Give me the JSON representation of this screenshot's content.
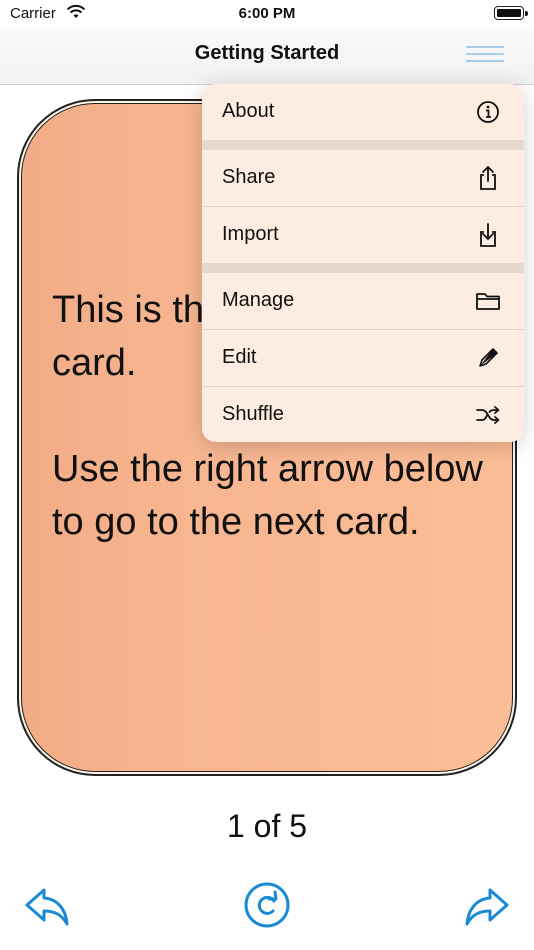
{
  "status": {
    "carrier": "Carrier",
    "time": "6:00 PM"
  },
  "nav": {
    "title": "Getting Started",
    "menu_icon": "hamburger-menu-icon"
  },
  "card": {
    "paragraph1": "This is the first card.",
    "paragraph2": "Use the right arrow below to go to the next card.",
    "visible_line1": "This is th",
    "visible_line2": "card."
  },
  "counter": "1 of 5",
  "menu": {
    "items": [
      {
        "label": "About",
        "icon": "info-circle-icon"
      },
      {
        "label": "Share",
        "icon": "share-icon"
      },
      {
        "label": "Import",
        "icon": "import-tray-icon"
      },
      {
        "label": "Manage",
        "icon": "folder-icon"
      },
      {
        "label": "Edit",
        "icon": "pencil-icon"
      },
      {
        "label": "Shuffle",
        "icon": "shuffle-icon"
      }
    ]
  },
  "toolbar": {
    "left": "back-arrow-icon",
    "center": "flip-refresh-icon",
    "right": "forward-arrow-icon"
  },
  "colors": {
    "accent": "#1a8ad6",
    "card": "#fbbd96",
    "menu": "#fcece1"
  }
}
